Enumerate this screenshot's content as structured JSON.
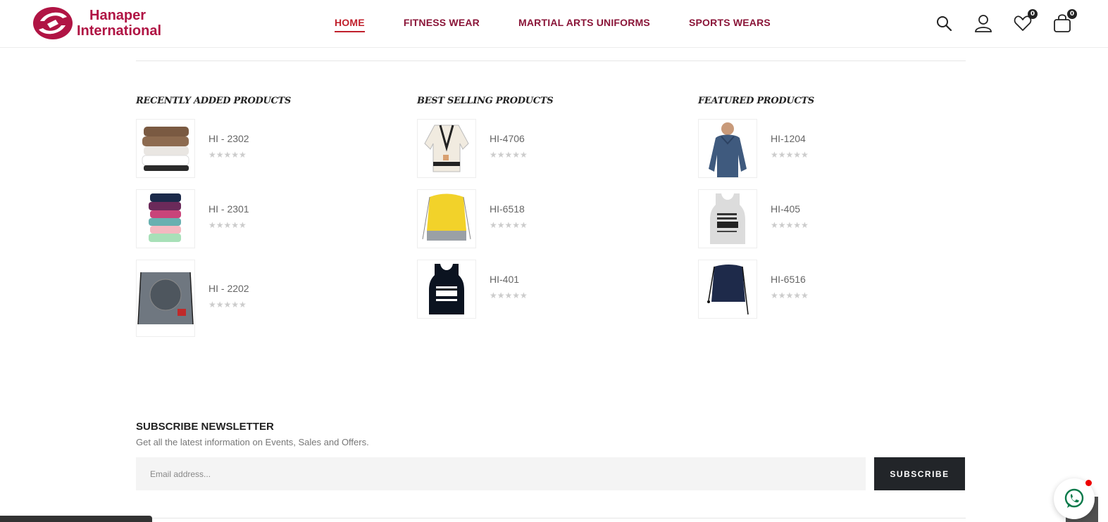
{
  "header": {
    "brand": {
      "line1": "Hanaper",
      "line2": "International"
    },
    "nav": [
      {
        "label": "HOME",
        "active": true
      },
      {
        "label": "FITNESS WEAR",
        "active": false
      },
      {
        "label": "MARTIAL ARTS UNIFORMS",
        "active": false
      },
      {
        "label": "SPORTS WEARS",
        "active": false
      }
    ],
    "icons": {
      "search": "search-icon",
      "account": "user-icon",
      "wishlist": "heart-icon",
      "cart": "bag-icon"
    },
    "wishlist_count": "0",
    "cart_count": "0"
  },
  "columns": [
    {
      "title": "RECENTLY ADDED PRODUCTS",
      "products": [
        {
          "name": "HI - 2302",
          "image": "stacked-towels-brown-white",
          "rating": 0
        },
        {
          "name": "HI - 2301",
          "image": "stacked-towels-colorful",
          "rating": 0
        },
        {
          "name": "HI - 2202",
          "image": "grey-drawstring-bag",
          "rating": 0
        }
      ]
    },
    {
      "title": "BEST SELLING PRODUCTS",
      "products": [
        {
          "name": "HI-4706",
          "image": "white-martial-arts-uniform",
          "rating": 0
        },
        {
          "name": "HI-6518",
          "image": "yellow-drawstring-bag",
          "rating": 0
        },
        {
          "name": "HI-401",
          "image": "black-gym-tank-top",
          "rating": 0
        }
      ]
    },
    {
      "title": "FEATURED PRODUCTS",
      "products": [
        {
          "name": "HI-1204",
          "image": "blue-hoodie-model",
          "rating": 0
        },
        {
          "name": "HI-405",
          "image": "grey-gym-tank-top",
          "rating": 0
        },
        {
          "name": "HI-6516",
          "image": "navy-drawstring-bag",
          "rating": 0
        }
      ]
    }
  ],
  "newsletter": {
    "title": "SUBSCRIBE NEWSLETTER",
    "subtitle": "Get all the latest information on Events, Sales and Offers.",
    "placeholder": "Email address...",
    "button": "SUBSCRIBE"
  },
  "colors": {
    "brand": "#b01444",
    "nav": "#8a1538",
    "active": "#c0202c",
    "button": "#222529"
  }
}
